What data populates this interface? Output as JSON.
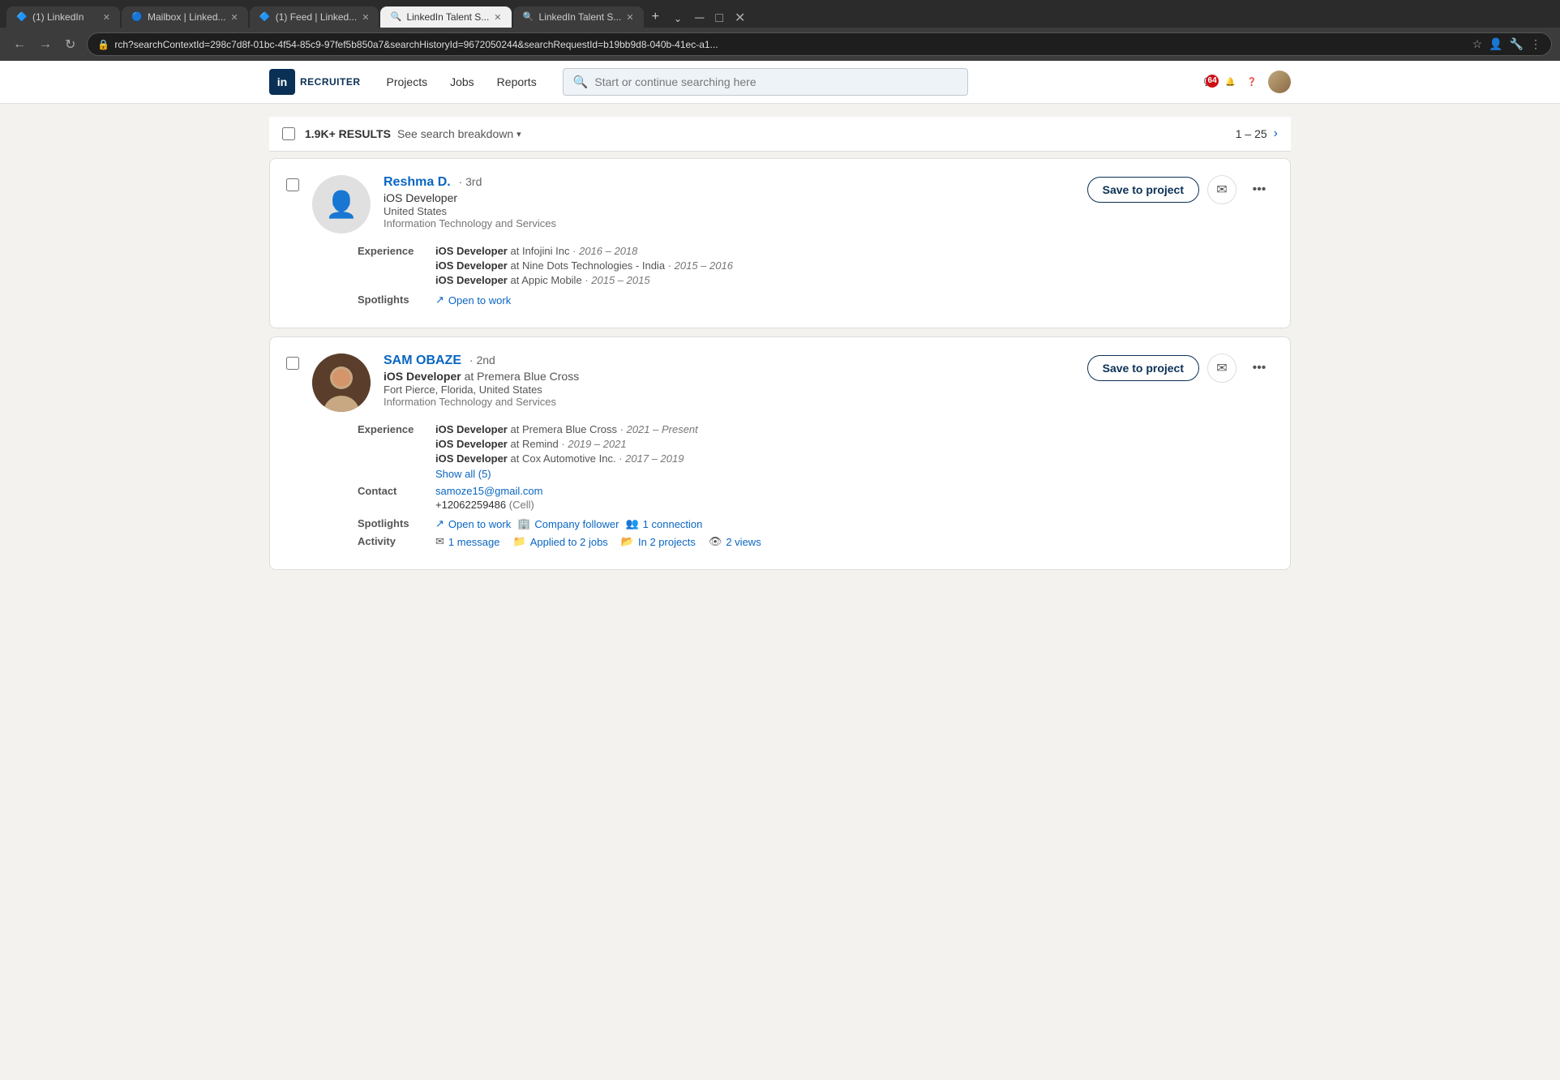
{
  "browser": {
    "tabs": [
      {
        "id": "tab1",
        "favicon": "in",
        "title": "(1) LinkedIn",
        "active": false
      },
      {
        "id": "tab2",
        "favicon": "✉",
        "title": "Mailbox | Linked...",
        "active": false
      },
      {
        "id": "tab3",
        "favicon": "in",
        "title": "(1) Feed | Linked...",
        "active": false
      },
      {
        "id": "tab4",
        "favicon": "🔍",
        "title": "LinkedIn Talent S...",
        "active": true
      },
      {
        "id": "tab5",
        "favicon": "🔍",
        "title": "LinkedIn Talent S...",
        "active": false
      }
    ],
    "address": "rch?searchContextId=298c7d8f-01bc-4f54-85c9-97fef5b850a7&searchHistoryId=9672050244&searchRequestId=b19bb9d8-040b-41ec-a1..."
  },
  "nav": {
    "logo": "in",
    "logo_text": "RECRUITER",
    "links": [
      "Projects",
      "Jobs",
      "Reports"
    ],
    "search_placeholder": "Start or continue searching here",
    "notification_count": "64"
  },
  "results": {
    "count": "1.9K+ RESULTS",
    "breakdown_label": "See search breakdown",
    "pagination": "1 – 25"
  },
  "candidates": [
    {
      "id": "reshma",
      "name": "Reshma D.",
      "degree": "· 3rd",
      "title": "iOS Developer",
      "location": "United States",
      "industry": "Information Technology and Services",
      "has_photo": false,
      "save_label": "Save to project",
      "experience": [
        {
          "role": "iOS Developer",
          "company": "Infojini Inc",
          "dates": "2016 – 2018"
        },
        {
          "role": "iOS Developer",
          "company": "Nine Dots Technologies - India",
          "dates": "2015 – 2016"
        },
        {
          "role": "iOS Developer",
          "company": "Appic Mobile",
          "dates": "2015 – 2015"
        }
      ],
      "spotlights": [
        {
          "icon": "↗",
          "label": "Open to work"
        }
      ]
    },
    {
      "id": "sam",
      "name": "SAM OBAZE",
      "degree": "· 2nd",
      "title": "iOS Developer",
      "title_company": "at Premera Blue Cross",
      "location": "Fort Pierce, Florida, United States",
      "industry": "Information Technology and Services",
      "has_photo": true,
      "save_label": "Save to project",
      "experience": [
        {
          "role": "iOS Developer",
          "company": "Premera Blue Cross",
          "dates": "2021 – Present"
        },
        {
          "role": "iOS Developer",
          "company": "Remind",
          "dates": "2019 – 2021"
        },
        {
          "role": "iOS Developer",
          "company": "Cox Automotive Inc.",
          "dates": "2017 – 2019"
        }
      ],
      "show_all": "Show all (5)",
      "contact": {
        "email": "samoze15@gmail.com",
        "phone": "+12062259486",
        "phone_type": "(Cell)"
      },
      "spotlights": [
        {
          "icon": "↗",
          "label": "Open to work"
        },
        {
          "icon": "🏢",
          "label": "Company follower"
        },
        {
          "icon": "👥",
          "label": "1 connection"
        }
      ],
      "activity": [
        {
          "icon": "✉",
          "label": "1 message"
        },
        {
          "icon": "📁",
          "label": "Applied to 2 jobs"
        },
        {
          "icon": "📂",
          "label": "In 2 projects"
        },
        {
          "icon": "👁",
          "label": "2 views"
        }
      ]
    }
  ]
}
